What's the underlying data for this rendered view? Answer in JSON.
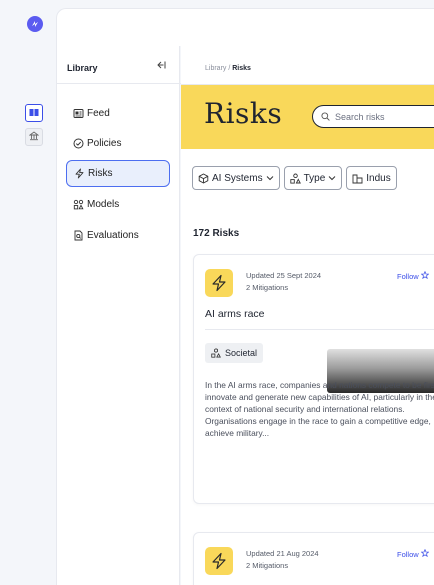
{
  "app": {
    "logo_icon": "app-logo-icon",
    "accent": "#3b4ee8",
    "hero_color": "#f9d85a"
  },
  "rail": {
    "items": [
      {
        "icon": "library-icon",
        "active": true
      },
      {
        "icon": "bank-icon",
        "active": false
      }
    ]
  },
  "sidebar": {
    "title": "Library",
    "collapse_icon": "collapse-left-icon",
    "items": [
      {
        "label": "Feed",
        "icon": "feed-icon",
        "active": false
      },
      {
        "label": "Policies",
        "icon": "shield-check-icon",
        "active": false
      },
      {
        "label": "Risks",
        "icon": "lightning-icon",
        "active": true
      },
      {
        "label": "Models",
        "icon": "models-icon",
        "active": false
      },
      {
        "label": "Evaluations",
        "icon": "evaluation-doc-icon",
        "active": false
      }
    ]
  },
  "breadcrumb": {
    "parent": "Library",
    "separator": " / ",
    "current": "Risks"
  },
  "hero": {
    "title": "Risks",
    "search_placeholder": "Search risks"
  },
  "filters": [
    {
      "label": "AI Systems",
      "icon": "ai-systems-icon"
    },
    {
      "label": "Type",
      "icon": "type-icon"
    },
    {
      "label": "Indus",
      "icon": "industry-icon"
    }
  ],
  "results": {
    "count_label": "172 Risks"
  },
  "cards": [
    {
      "updated": "Updated 25 Sept 2024",
      "mitigations": "2 Mitigations",
      "follow": "Follow",
      "title": "AI arms race",
      "tag": "Societal",
      "description": "In the AI arms race, companies and nations compete to be first to innovate and generate new capabilities of AI, particularly in the context of national security and international relations. Organisations engage in the race to gain a competitive edge, achieve military..."
    },
    {
      "updated": "Updated 21 Aug 2024",
      "mitigations": "2 Mitigations",
      "follow": "Follow"
    }
  ]
}
